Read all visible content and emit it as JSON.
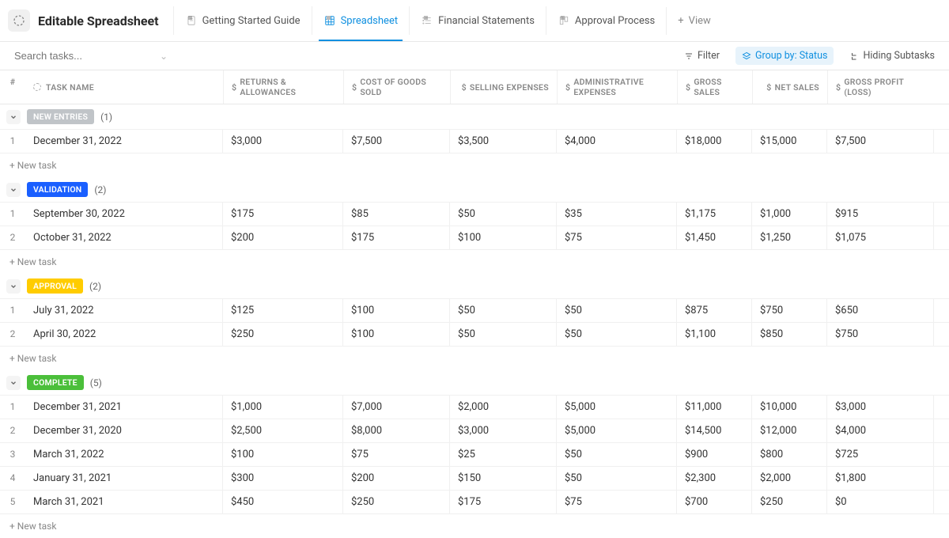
{
  "header": {
    "title": "Editable Spreadsheet",
    "tabs": [
      {
        "label": "Getting Started Guide",
        "icon": "doc"
      },
      {
        "label": "Spreadsheet",
        "icon": "grid",
        "active": true
      },
      {
        "label": "Financial Statements",
        "icon": "list"
      },
      {
        "label": "Approval Process",
        "icon": "board"
      }
    ],
    "add_view": "View"
  },
  "toolbar": {
    "search_placeholder": "Search tasks...",
    "filter": "Filter",
    "group_by": "Group by: Status",
    "hiding": "Hiding Subtasks"
  },
  "columns": {
    "num": "#",
    "name": "TASK NAME",
    "c1": "RETURNS & ALLOWANCES",
    "c2": "COST OF GOODS SOLD",
    "c3": "SELLING EXPENSES",
    "c4": "ADMINISTRATIVE EXPENSES",
    "c5": "GROSS SALES",
    "c6": "NET SALES",
    "c7": "GROSS PROFIT (LOSS)"
  },
  "new_task_label": "+ New task",
  "groups": [
    {
      "name": "NEW ENTRIES",
      "color": "gray",
      "count": "(1)",
      "rows": [
        {
          "n": "1",
          "name": "December 31, 2022",
          "c1": "$3,000",
          "c2": "$7,500",
          "c3": "$3,500",
          "c4": "$4,000",
          "c5": "$18,000",
          "c6": "$15,000",
          "c7": "$7,500"
        }
      ]
    },
    {
      "name": "VALIDATION",
      "color": "blue",
      "count": "(2)",
      "rows": [
        {
          "n": "1",
          "name": "September 30, 2022",
          "c1": "$175",
          "c2": "$85",
          "c3": "$50",
          "c4": "$35",
          "c5": "$1,175",
          "c6": "$1,000",
          "c7": "$915"
        },
        {
          "n": "2",
          "name": "October 31, 2022",
          "c1": "$200",
          "c2": "$175",
          "c3": "$100",
          "c4": "$75",
          "c5": "$1,450",
          "c6": "$1,250",
          "c7": "$1,075"
        }
      ]
    },
    {
      "name": "APPROVAL",
      "color": "yellow",
      "count": "(2)",
      "rows": [
        {
          "n": "1",
          "name": "July 31, 2022",
          "c1": "$125",
          "c2": "$100",
          "c3": "$50",
          "c4": "$50",
          "c5": "$875",
          "c6": "$750",
          "c7": "$650"
        },
        {
          "n": "2",
          "name": "April 30, 2022",
          "c1": "$250",
          "c2": "$100",
          "c3": "$50",
          "c4": "$50",
          "c5": "$1,100",
          "c6": "$850",
          "c7": "$750"
        }
      ]
    },
    {
      "name": "COMPLETE",
      "color": "green",
      "count": "(5)",
      "rows": [
        {
          "n": "1",
          "name": "December 31, 2021",
          "c1": "$1,000",
          "c2": "$7,000",
          "c3": "$2,000",
          "c4": "$5,000",
          "c5": "$11,000",
          "c6": "$10,000",
          "c7": "$3,000"
        },
        {
          "n": "2",
          "name": "December 31, 2020",
          "c1": "$2,500",
          "c2": "$8,000",
          "c3": "$3,000",
          "c4": "$5,000",
          "c5": "$14,500",
          "c6": "$12,000",
          "c7": "$4,000"
        },
        {
          "n": "3",
          "name": "March 31, 2022",
          "c1": "$100",
          "c2": "$75",
          "c3": "$25",
          "c4": "$50",
          "c5": "$900",
          "c6": "$800",
          "c7": "$725"
        },
        {
          "n": "4",
          "name": "January 31, 2021",
          "c1": "$300",
          "c2": "$200",
          "c3": "$150",
          "c4": "$50",
          "c5": "$2,300",
          "c6": "$2,000",
          "c7": "$1,800"
        },
        {
          "n": "5",
          "name": "March 31, 2021",
          "c1": "$450",
          "c2": "$250",
          "c3": "$175",
          "c4": "$75",
          "c5": "$700",
          "c6": "$250",
          "c7": "$0"
        }
      ]
    }
  ]
}
